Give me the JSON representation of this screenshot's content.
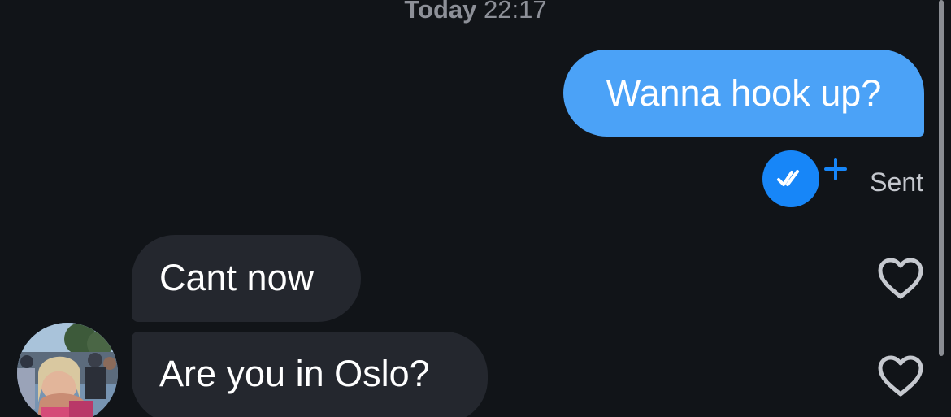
{
  "conversation": {
    "timestamp_day": "Today",
    "timestamp_time": "22:17"
  },
  "messages": [
    {
      "direction": "outgoing",
      "text": "Wanna hook up?",
      "status": "Sent"
    },
    {
      "direction": "incoming",
      "text": "Cant now",
      "liked": false
    },
    {
      "direction": "incoming",
      "text": "Are you in Oslo?",
      "liked": false
    }
  ],
  "icons": {
    "read_receipt": "double-check-icon",
    "plus": "plus-icon",
    "like": "heart-icon"
  },
  "colors": {
    "background": "#111418",
    "outgoing_bubble": "#4ba2f7",
    "incoming_bubble": "#24272e",
    "receipt_badge": "#1786f8",
    "timestamp_text": "#8d9098"
  }
}
